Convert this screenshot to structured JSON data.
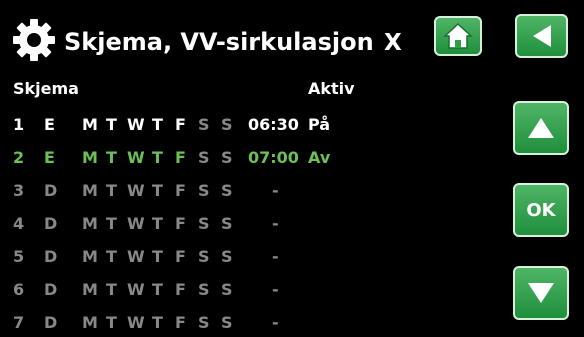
{
  "header": {
    "title": "Skjema, VV-sirkulasjon",
    "close_label": "X"
  },
  "columns": {
    "schedule": "Skjema",
    "active": "Aktiv"
  },
  "buttons": {
    "ok_label": "OK"
  },
  "rows": [
    {
      "num": "1",
      "mode": "E",
      "days": [
        "M",
        "T",
        "W",
        "T",
        "F",
        "S",
        "S"
      ],
      "time": "06:30",
      "active": "På"
    },
    {
      "num": "2",
      "mode": "E",
      "days": [
        "M",
        "T",
        "W",
        "T",
        "F",
        "S",
        "S"
      ],
      "time": "07:00",
      "active": "Av"
    },
    {
      "num": "3",
      "mode": "D",
      "days": [
        "M",
        "T",
        "W",
        "T",
        "F",
        "S",
        "S"
      ],
      "time": "-",
      "active": ""
    },
    {
      "num": "4",
      "mode": "D",
      "days": [
        "M",
        "T",
        "W",
        "T",
        "F",
        "S",
        "S"
      ],
      "time": "-",
      "active": ""
    },
    {
      "num": "5",
      "mode": "D",
      "days": [
        "M",
        "T",
        "W",
        "T",
        "F",
        "S",
        "S"
      ],
      "time": "-",
      "active": ""
    },
    {
      "num": "6",
      "mode": "D",
      "days": [
        "M",
        "T",
        "W",
        "T",
        "F",
        "S",
        "S"
      ],
      "time": "-",
      "active": ""
    },
    {
      "num": "7",
      "mode": "D",
      "days": [
        "M",
        "T",
        "W",
        "T",
        "F",
        "S",
        "S"
      ],
      "time": "-",
      "active": ""
    }
  ],
  "colors": {
    "background": "#000000",
    "text": "#ffffff",
    "selected": "#6dbf57",
    "disabled": "#888888",
    "button": "#2e9e48"
  }
}
